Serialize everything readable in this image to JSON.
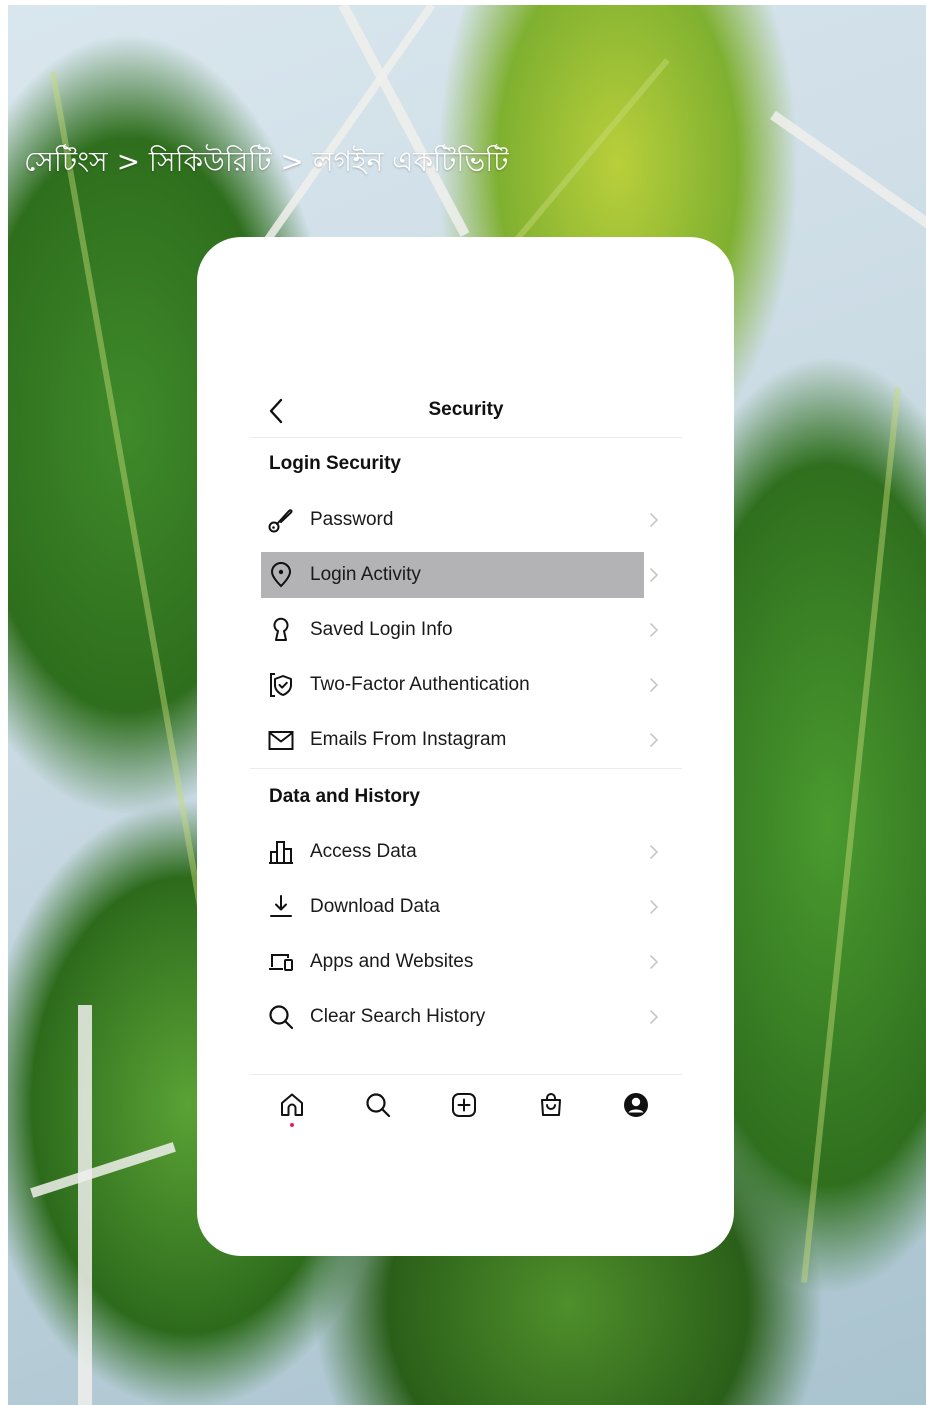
{
  "breadcrumb": "সেটিংস > সিকিউরিটি > লগইন একটিভিটি",
  "header": {
    "title": "Security"
  },
  "sections": [
    {
      "title": "Login Security",
      "items": [
        {
          "label": "Password",
          "icon": "key-icon"
        },
        {
          "label": "Login Activity",
          "icon": "location-pin-icon",
          "highlighted": true
        },
        {
          "label": "Saved Login Info",
          "icon": "keyhole-icon"
        },
        {
          "label": "Two-Factor Authentication",
          "icon": "shield-check-icon"
        },
        {
          "label": "Emails From Instagram",
          "icon": "mail-icon"
        }
      ]
    },
    {
      "title": "Data and History",
      "items": [
        {
          "label": "Access Data",
          "icon": "bar-chart-icon"
        },
        {
          "label": "Download Data",
          "icon": "download-icon"
        },
        {
          "label": "Apps and Websites",
          "icon": "devices-icon"
        },
        {
          "label": "Clear Search History",
          "icon": "search-icon"
        }
      ]
    }
  ],
  "tabbar": {
    "items": [
      "home-icon",
      "search-icon",
      "add-post-icon",
      "shop-icon",
      "profile-icon"
    ],
    "active": "home-icon",
    "notification_dot_color": "#e0245e"
  },
  "colors": {
    "highlight": "#b3b2b4",
    "card": "#ffffff",
    "text": "#1a1a1a"
  }
}
